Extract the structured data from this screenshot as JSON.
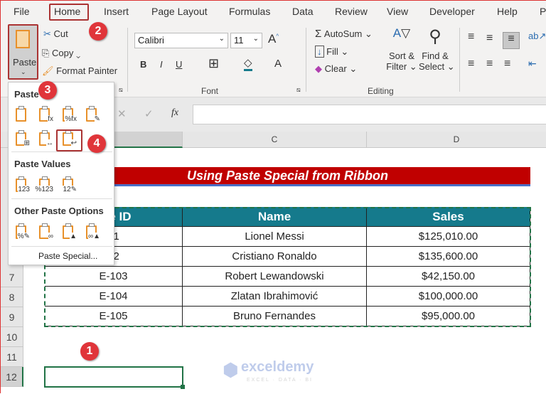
{
  "ribbon_tabs": [
    "File",
    "Home",
    "Insert",
    "Page Layout",
    "Formulas",
    "Data",
    "Review",
    "View",
    "Developer",
    "Help",
    "P"
  ],
  "clipboard": {
    "paste": "Paste",
    "cut": "Cut",
    "copy": "Copy",
    "format_painter": "Format Painter"
  },
  "font": {
    "name": "Calibri",
    "size": "11",
    "group": "Font",
    "bold": "B",
    "italic": "I",
    "underline": "U"
  },
  "editing": {
    "autosum": "AutoSum",
    "fill": "Fill",
    "clear": "Clear",
    "sort": "Sort &",
    "filter": "Filter",
    "find": "Find &",
    "select": "Select",
    "group": "Editing"
  },
  "formula_bar": {
    "fx": "fx",
    "cancel": "✕",
    "enter": "✓",
    "value": ""
  },
  "paste_menu": {
    "paste_header": "Paste",
    "values_header": "Paste Values",
    "other_header": "Other Paste Options",
    "paste_special": "Paste Special...",
    "paste_icons": [
      "",
      "fx",
      "%fx",
      "✎",
      "⊞",
      "↔",
      "↩"
    ],
    "values_icons": [
      "123",
      "%123",
      "12✎"
    ],
    "other_icons": [
      "%✎",
      "∞",
      "▲",
      "∞▲"
    ]
  },
  "columns": [
    "C",
    "D"
  ],
  "rows": [
    "7",
    "8",
    "9",
    "10",
    "11",
    "12"
  ],
  "sheet": {
    "title": "Using Paste Special from Ribbon",
    "headers": [
      "yee ID",
      "Name",
      "Sales"
    ],
    "data": [
      [
        "01",
        "Lionel Messi",
        "$125,010.00"
      ],
      [
        "02",
        "Cristiano Ronaldo",
        "$135,600.00"
      ],
      [
        "E-103",
        "Robert Lewandowski",
        "$42,150.00"
      ],
      [
        "E-104",
        "Zlatan Ibrahimović",
        "$100,000.00"
      ],
      [
        "E-105",
        "Bruno Fernandes",
        "$95,000.00"
      ]
    ]
  },
  "badges": [
    "1",
    "2",
    "3",
    "4"
  ],
  "watermark": {
    "name": "exceldemy",
    "tag": "EXCEL · DATA · BI"
  },
  "colors": {
    "title_bg": "#c00000",
    "header_bg": "#157a8c",
    "selection": "#217346",
    "badge": "#e0353a"
  }
}
